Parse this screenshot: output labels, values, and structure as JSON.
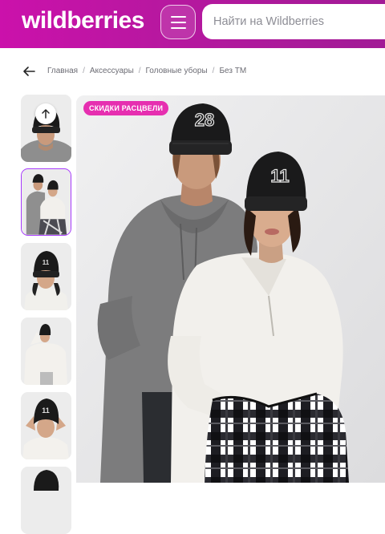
{
  "header": {
    "logo": "wildberries",
    "menu_icon": "hamburger-menu-icon",
    "search_placeholder": "Найти на Wildberries"
  },
  "breadcrumb": {
    "back_icon": "arrow-left-icon",
    "items": [
      "Главная",
      "Аксессуары",
      "Головные уборы",
      "Без ТМ"
    ]
  },
  "gallery": {
    "scroll_up_icon": "arrow-up-icon",
    "thumbnail_count_visible": 6,
    "active_thumbnail": 2
  },
  "product": {
    "promo_badge": "СКИДКИ РАСЦВЕЛИ",
    "beanie_numbers": [
      "28",
      "11"
    ]
  },
  "colors": {
    "brand_start": "#cb11ab",
    "brand_end": "#a11b96",
    "badge": "#e62fb0",
    "active_border": "#a73afd"
  }
}
